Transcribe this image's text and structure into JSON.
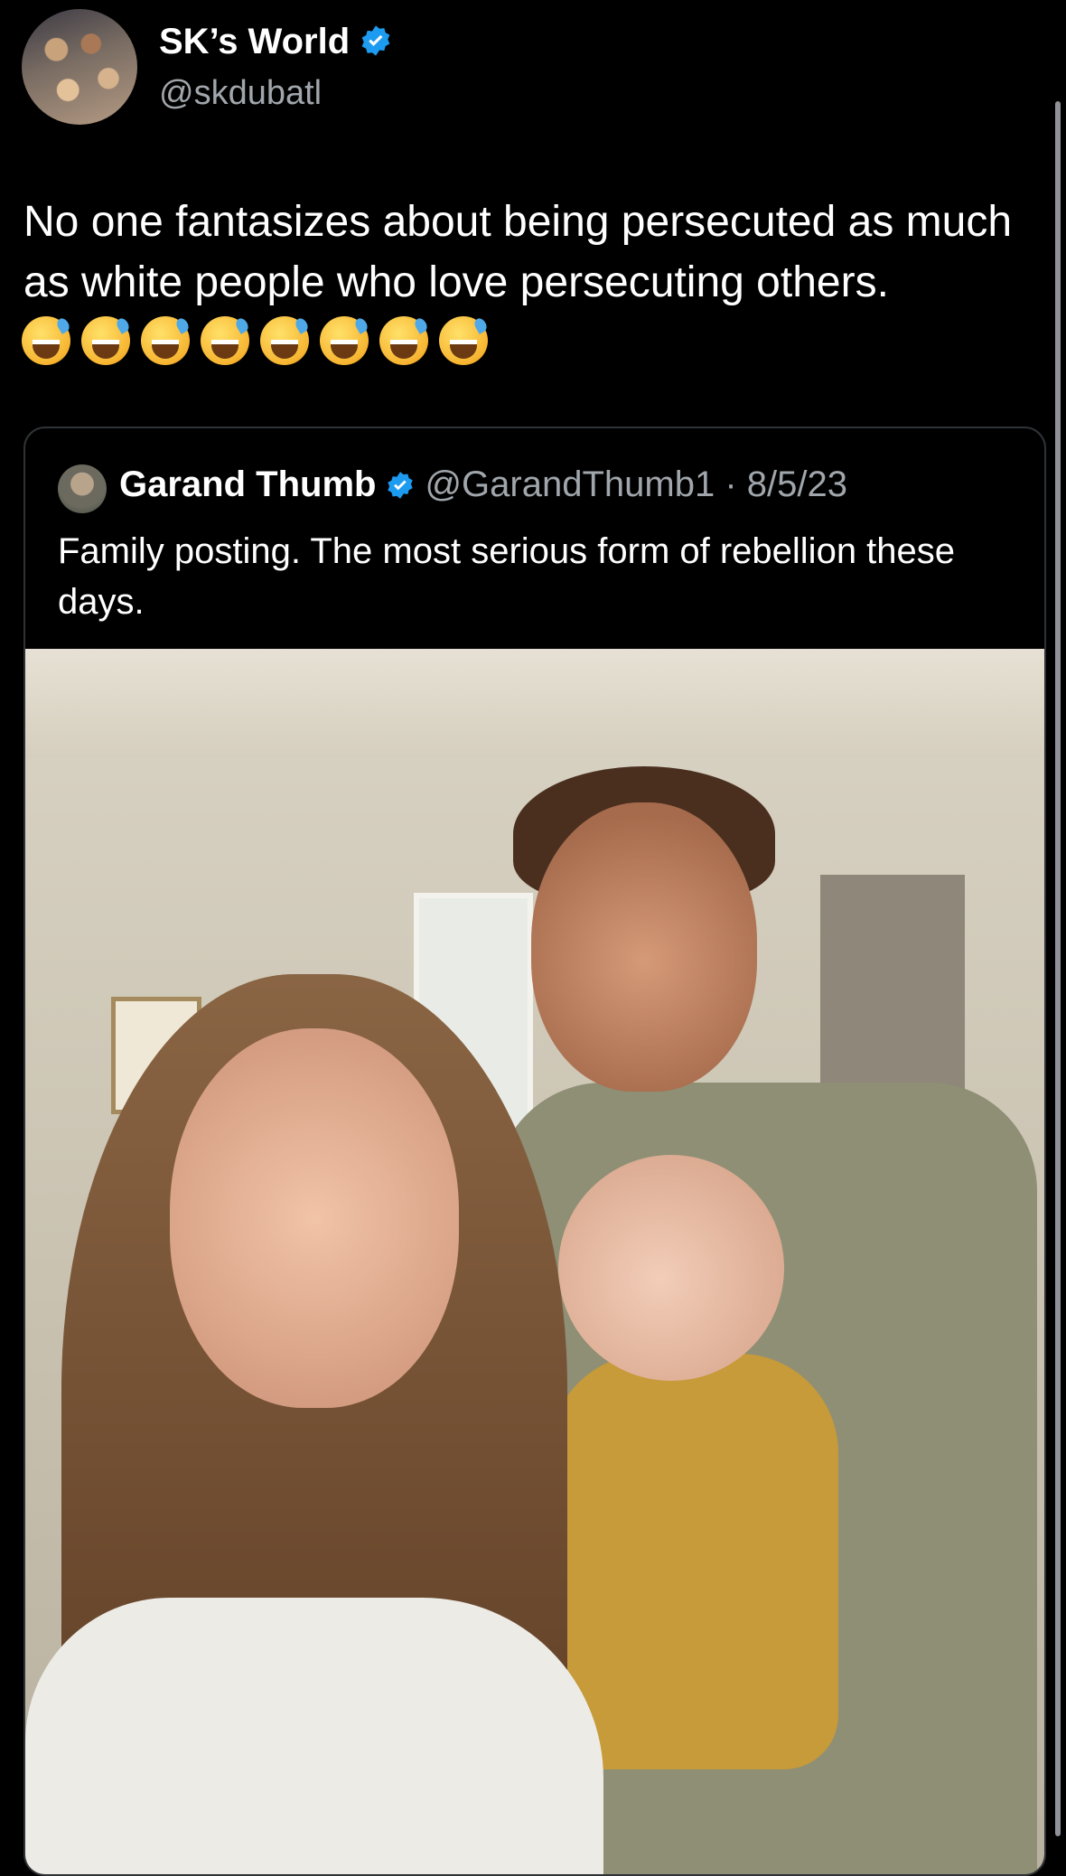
{
  "tweet": {
    "display_name": "SK’s World",
    "handle": "@skdubatl",
    "text": "No one fantasizes about being persecuted as much as white people who love persecuting others.",
    "emoji": "sweat-smile-emoji",
    "emoji_count": 8
  },
  "quoted_tweet": {
    "display_name": "Garand Thumb",
    "meta": "@GarandThumb1 · 8/5/23",
    "text": "Family posting. The most serious form of rebellion these days."
  },
  "colors": {
    "background": "#000000",
    "verified_badge": "#1d9bf0",
    "secondary_text": "#a0a6ab",
    "border": "#2f3336"
  }
}
